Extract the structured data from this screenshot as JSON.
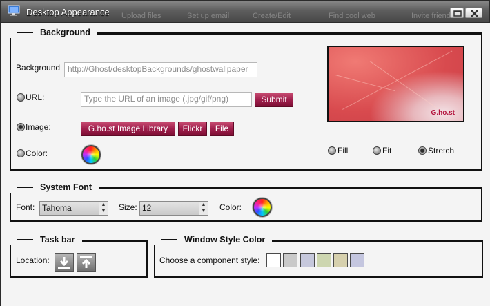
{
  "window": {
    "title": "Desktop Appearance",
    "background_menu": [
      "Upload files",
      "Set up email",
      "Create/Edit",
      "Find cool web",
      "Invite friends"
    ]
  },
  "icons": {
    "app": "desktop-icon",
    "restore": "restore-icon",
    "close": "close-icon",
    "color_picker": "color-wheel-icon",
    "taskbar_bottom": "taskbar-bottom-icon",
    "taskbar_top": "taskbar-top-icon"
  },
  "background_section": {
    "legend": "Background",
    "background_label": "Background",
    "background_value": "http://Ghost/desktopBackgrounds/ghostwallpaper",
    "url_label": "URL:",
    "url_placeholder": "Type the URL of an image (.jpg/gif/png)",
    "submit_label": "Submit",
    "image_label": "Image:",
    "image_buttons": [
      "G.ho.st Image Library",
      "Flickr",
      "File"
    ],
    "color_label": "Color:",
    "selected_source": "Image",
    "preview_logo": "G.ho.st",
    "fit_options": [
      {
        "label": "Fill",
        "selected": false
      },
      {
        "label": "Fit",
        "selected": false
      },
      {
        "label": "Stretch",
        "selected": true
      }
    ]
  },
  "font_section": {
    "legend": "System Font",
    "font_label": "Font:",
    "font_value": "Tahoma",
    "size_label": "Size:",
    "size_value": "12",
    "color_label": "Color:"
  },
  "taskbar_section": {
    "legend": "Task bar",
    "location_label": "Location:"
  },
  "window_style_section": {
    "legend": "Window Style Color",
    "choose_label": "Choose a component style:",
    "swatches": [
      "#ffffff",
      "#c9c9c9",
      "#c6c8dc",
      "#cdd6b0",
      "#d6d0ad",
      "#c4c6df"
    ]
  },
  "colors": {
    "accent_button": "#a01f4c",
    "titlebar": "#5e5e5e",
    "panel_background": "#f4f4f4"
  }
}
